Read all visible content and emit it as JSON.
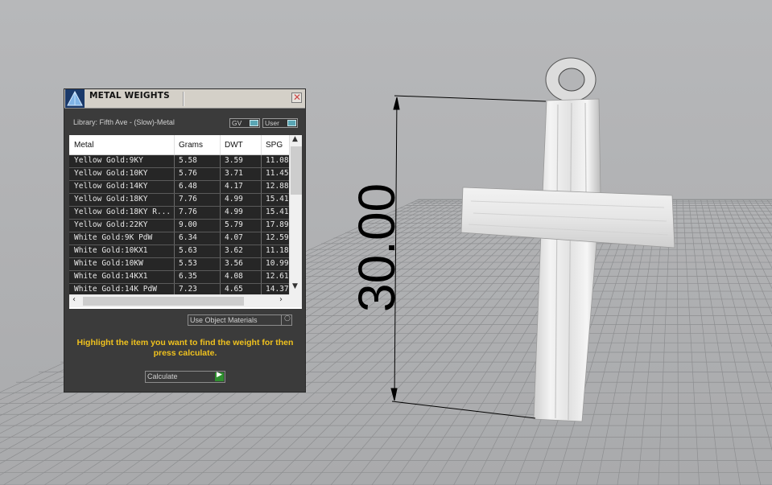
{
  "viewport": {
    "dimension_text": "30.00"
  },
  "panel": {
    "title": "METAL WEIGHTS",
    "close_icon": "close-icon",
    "library": "Library: Fifth Ave - (Slow)-Metal",
    "toggle_gv": "GV",
    "toggle_user": "User",
    "columns": [
      "Metal",
      "Grams",
      "DWT",
      "SPG"
    ],
    "rows": [
      {
        "metal": "Yellow Gold:9KY",
        "grams": "5.58",
        "dwt": "3.59",
        "spg": "11.08"
      },
      {
        "metal": "Yellow Gold:10KY",
        "grams": "5.76",
        "dwt": "3.71",
        "spg": "11.45"
      },
      {
        "metal": "Yellow Gold:14KY",
        "grams": "6.48",
        "dwt": "4.17",
        "spg": "12.88"
      },
      {
        "metal": "Yellow Gold:18KY",
        "grams": "7.76",
        "dwt": "4.99",
        "spg": "15.41"
      },
      {
        "metal": "Yellow Gold:18KY R...",
        "grams": "7.76",
        "dwt": "4.99",
        "spg": "15.41"
      },
      {
        "metal": "Yellow Gold:22KY",
        "grams": "9.00",
        "dwt": "5.79",
        "spg": "17.89"
      },
      {
        "metal": "White Gold:9K PdW",
        "grams": "6.34",
        "dwt": "4.07",
        "spg": "12.59"
      },
      {
        "metal": "White Gold:10KX1",
        "grams": "5.63",
        "dwt": "3.62",
        "spg": "11.18"
      },
      {
        "metal": "White Gold:10KW",
        "grams": "5.53",
        "dwt": "3.56",
        "spg": "10.99"
      },
      {
        "metal": "White Gold:14KX1",
        "grams": "6.35",
        "dwt": "4.08",
        "spg": "12.61"
      },
      {
        "metal": "White Gold:14K PdW",
        "grams": "7.23",
        "dwt": "4.65",
        "spg": "14.37"
      }
    ],
    "use_object_materials": "Use Object Materials",
    "hint": "Highlight the item you want to find the weight for then press calculate.",
    "calculate": "Calculate",
    "colors": {
      "hint": "#f0c21e",
      "panel_bg": "#3b3b3b",
      "toggle": "#5aa6b4",
      "go": "#2f8f2f"
    }
  }
}
